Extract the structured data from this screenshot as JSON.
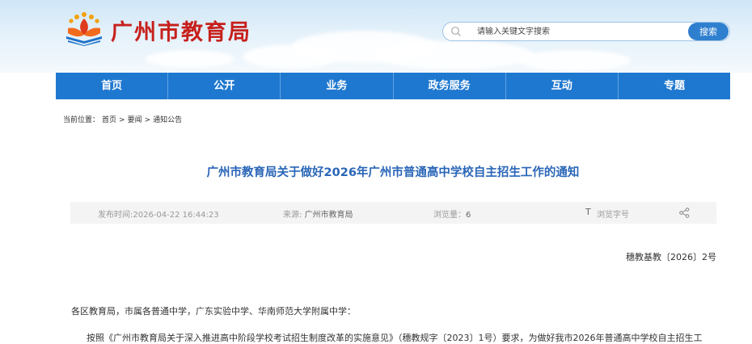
{
  "header": {
    "site_title": "广州市教育局",
    "search_placeholder": "请输入关键文字搜索",
    "search_button": "搜索"
  },
  "nav": {
    "items": [
      "首页",
      "公开",
      "业务",
      "政务服务",
      "互动",
      "专题"
    ]
  },
  "breadcrumb": {
    "label": "当前位置：",
    "items": [
      "首页",
      ">",
      "要闻",
      ">",
      "通知公告"
    ]
  },
  "article": {
    "title": "广州市教育局关于做好2026年广州市普通高中学校自主招生工作的通知",
    "publish_time": "发布时间:2026-04-22 16:44:23",
    "source_label": "来源: ",
    "source_value": "广州市教育局",
    "views_label": "浏览量：",
    "views_value": "6",
    "font_icon_glyph": "T",
    "font_size_label": "浏览字号",
    "doc_number": "穗教基教〔2026〕2号",
    "addressee": "各区教育局，市属各普通中学，广东实验中学、华南师范大学附属中学：",
    "paragraph_1": "按照《广州市教育局关于深入推进高中阶段学校考试招生制度改革的实施意见》（穗教规字〔2023〕1号）要求，为做好我市2026年普通高中学校自主招生工"
  },
  "colors": {
    "nav_bg": "#1f78d0",
    "title_red": "#c7201c",
    "article_title_blue": "#2a66b8",
    "search_button_bg": "#2f7fcf"
  }
}
